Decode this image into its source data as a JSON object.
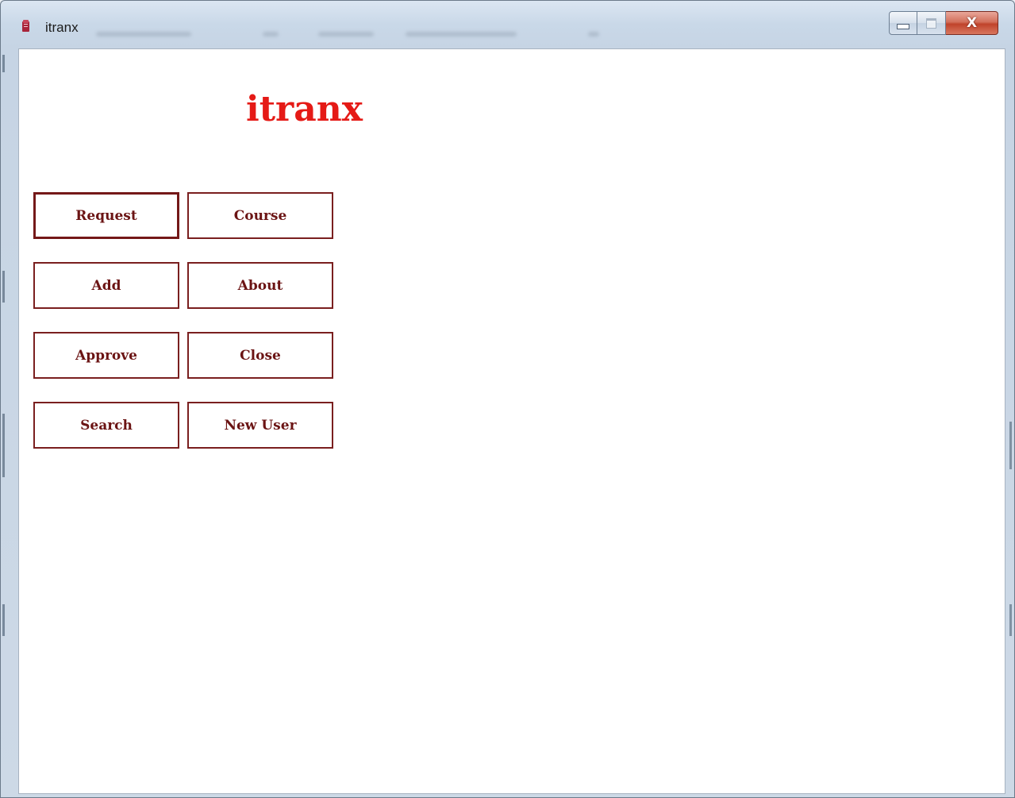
{
  "window": {
    "title": "itranx",
    "controls": {
      "minimize": "minimize",
      "maximize": "maximize",
      "close": "X"
    }
  },
  "app": {
    "heading": "itranx",
    "heading_color": "#e51a16",
    "button_text_color": "#6b1414",
    "buttons": [
      {
        "label": "Request",
        "focused": true
      },
      {
        "label": "Course"
      },
      {
        "label": "Add"
      },
      {
        "label": "About"
      },
      {
        "label": "Approve"
      },
      {
        "label": "Close"
      },
      {
        "label": "Search"
      },
      {
        "label": "New User"
      }
    ]
  },
  "icons": {
    "app_icon": "app-icon",
    "minimize": "minimize-icon",
    "maximize": "maximize-icon",
    "close": "close-icon"
  }
}
